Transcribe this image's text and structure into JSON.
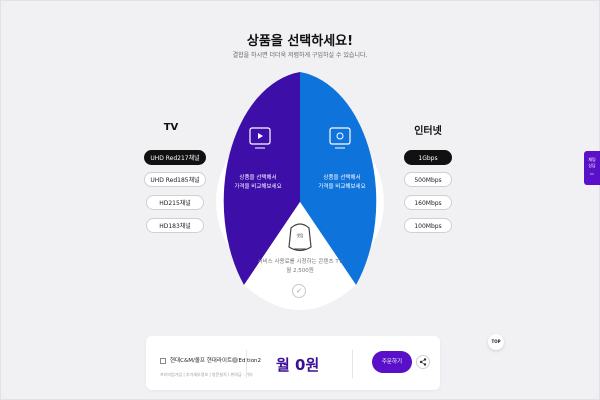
{
  "header": {
    "title": "상품을 선택하세요!",
    "subtitle": "결합을 하시면 더더욱 저렴하게 구입하실 수 있습니다."
  },
  "tv": {
    "title": "TV",
    "options": [
      {
        "label": "UHD Red217채널",
        "selected": true
      },
      {
        "label": "UHD Red185채널",
        "selected": false
      },
      {
        "label": "HD215채널",
        "selected": false
      },
      {
        "label": "HD183채널",
        "selected": false
      }
    ]
  },
  "internet": {
    "title": "인터넷",
    "options": [
      {
        "label": "1Gbps",
        "selected": true
      },
      {
        "label": "500Mbps",
        "selected": false
      },
      {
        "label": "160Mbps",
        "selected": false
      },
      {
        "label": "100Mbps",
        "selected": false
      }
    ]
  },
  "diagram": {
    "left_text_1": "상품을 선택해서",
    "left_text_2": "가격을 비교해보세요",
    "right_text_1": "상품을 선택해서",
    "right_text_2": "가격을 비교해보세요",
    "bottom_text_1": "서비스 사용료를 시청하는 콘텐츠 TV",
    "bottom_text_2": "월 2,500원",
    "device_label": "셋탑",
    "colors": {
      "left": "#3d0ea8",
      "right": "#0f73dc",
      "bottom": "#ffffff"
    }
  },
  "bottom_bar": {
    "checkbox_label": "현대C&M/올프 현대라이트M Edition2",
    "note": "프리미엄가입 | 추가세부정보 | 방문설치 / 위약금 · 기타",
    "price": "월 0원",
    "order_label": "주문하기",
    "share_icon": "share-icon"
  },
  "floating": {
    "top_label": "TOP",
    "side_tab_label_1": "채팅",
    "side_tab_label_2": "상담"
  }
}
